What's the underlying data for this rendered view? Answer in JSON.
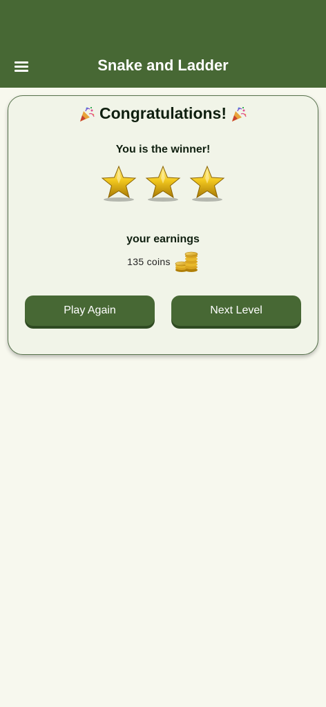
{
  "appbar": {
    "title": "Snake and Ladder",
    "menu_icon": "hamburger-menu-icon",
    "background": "#476834"
  },
  "result": {
    "heading": "Congratulations!",
    "heading_icon": "party-popper-icon",
    "winner_text": "You is the winner!",
    "stars_earned": 3,
    "stars_total": 3,
    "star_icon": "gold-star-icon",
    "earnings_label": "your earnings",
    "coins_text": "135 coins",
    "coins_icon": "gold-coins-icon"
  },
  "buttons": {
    "play_again": "Play Again",
    "next_level": "Next Level",
    "color": "#476834"
  },
  "colors": {
    "page_background": "#f7f8ee",
    "card_background": "#f1f4e8"
  }
}
